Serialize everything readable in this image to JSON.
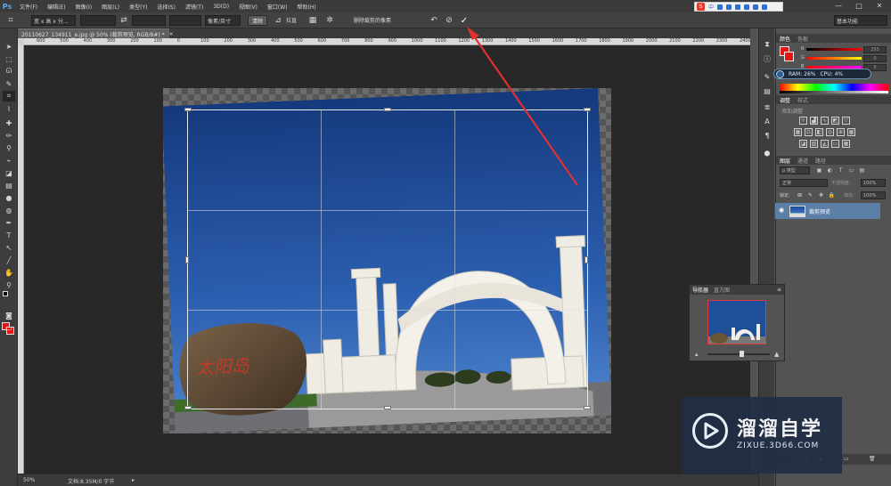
{
  "app": {
    "logo": "Ps"
  },
  "menu": [
    "文件(F)",
    "编辑(E)",
    "图像(I)",
    "图层(L)",
    "类型(Y)",
    "选择(S)",
    "滤镜(T)",
    "3D(D)",
    "视图(V)",
    "窗口(W)",
    "帮助(H)"
  ],
  "sogou": {
    "logo": "S",
    "text": "中"
  },
  "window_controls": [
    "—",
    "□",
    "✕"
  ],
  "options": {
    "ratio_select": "宽 x 高 x 分...",
    "swap_icon": "⇄",
    "unit_select": "像素/英寸",
    "clear_button": "清除",
    "straighten_label": "拉直",
    "delete_pixels_label": "删除裁剪的像素",
    "undo_icon": "↶",
    "cancel_icon": "⊘",
    "commit_icon": "✓",
    "workspace": "基本功能"
  },
  "document": {
    "tab_title": "20110627_134911_e.jpg @ 50% (裁剪预览, RGB/8#) *",
    "close_icon": "×",
    "ruler_ticks": [
      "600",
      "500",
      "400",
      "300",
      "200",
      "100",
      "0",
      "100",
      "200",
      "300",
      "400",
      "500",
      "600",
      "700",
      "800",
      "900",
      "1000",
      "1100",
      "1200",
      "1300",
      "1400",
      "1500",
      "1600",
      "1700",
      "1800",
      "1900",
      "2000",
      "2100",
      "2200",
      "2300",
      "2400"
    ]
  },
  "photo": {
    "inscription": "太阳岛"
  },
  "status": {
    "zoom": "50%",
    "doc_info": "文档:8.35M/0 字节",
    "arrow": "▸"
  },
  "colors": {
    "foreground": "#e61515",
    "background": "#e61515",
    "accent": "#e03030"
  },
  "panels": {
    "color_tabs": [
      "颜色",
      "色板"
    ],
    "color_values": [
      "255",
      "0",
      "0"
    ],
    "color_labels": [
      "R",
      "G",
      "B"
    ],
    "ram_text": "RAM: 26%",
    "cpu_text": "CPU: 4%",
    "adjust_tabs": [
      "调整",
      "样式"
    ],
    "adjust_add": "添加调整",
    "layers_tabs": [
      "图层",
      "通道",
      "路径"
    ],
    "layers_kind": "ρ 类型",
    "blend_mode": "正常",
    "opacity_label": "不透明度:",
    "opacity_value": "100%",
    "lock_label": "锁定:",
    "fill_label": "填充:",
    "fill_value": "100%",
    "layer_name": "裁剪预览",
    "layer_footer_icons": [
      "fx",
      "◐",
      "□",
      "▭",
      "🗑"
    ]
  },
  "navigator": {
    "tabs": [
      "导航器",
      "直方图"
    ],
    "menu_icon": "≡"
  },
  "watermark": {
    "title": "溜溜自学",
    "url": "ZIXUE.3D66.COM"
  }
}
